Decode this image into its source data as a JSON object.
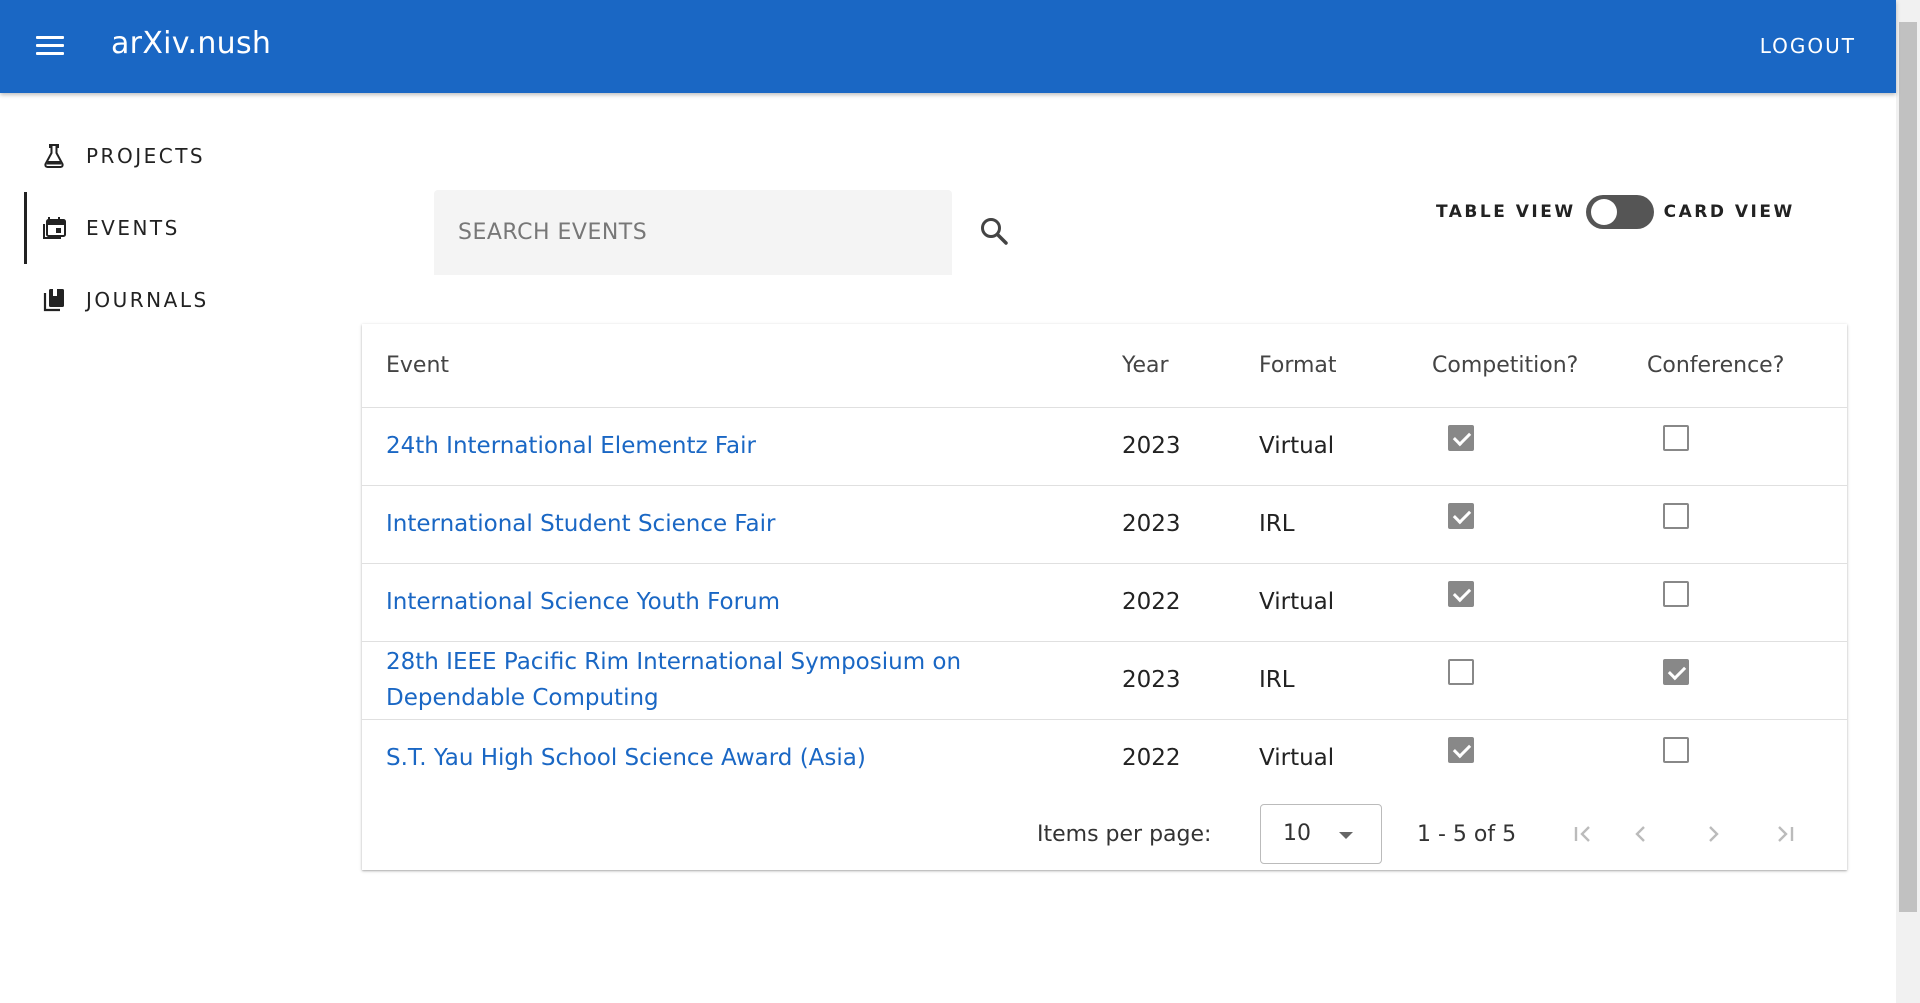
{
  "header": {
    "title": "arXiv.nush",
    "logout_label": "LOGOUT",
    "bg_color": "#1a67c4"
  },
  "sidebar": {
    "items": [
      {
        "label": "PROJECTS",
        "icon": "flask-icon",
        "active": false
      },
      {
        "label": "EVENTS",
        "icon": "event-calendar-icon",
        "active": true
      },
      {
        "label": "JOURNALS",
        "icon": "book-icon",
        "active": false
      }
    ]
  },
  "search": {
    "placeholder": "SEARCH EVENTS",
    "value": ""
  },
  "view_toggle": {
    "left_label": "TABLE VIEW",
    "right_label": "CARD VIEW",
    "state": "table"
  },
  "table": {
    "columns": [
      "Event",
      "Year",
      "Format",
      "Competition?",
      "Conference?"
    ],
    "rows": [
      {
        "event": "24th International Elementz Fair",
        "year": "2023",
        "format": "Virtual",
        "competition": true,
        "conference": false
      },
      {
        "event": "International Student Science Fair",
        "year": "2023",
        "format": "IRL",
        "competition": true,
        "conference": false
      },
      {
        "event": "International Science Youth Forum",
        "year": "2022",
        "format": "Virtual",
        "competition": true,
        "conference": false
      },
      {
        "event": "28th IEEE Pacific Rim International Symposium on Dependable Computing",
        "year": "2023",
        "format": "IRL",
        "competition": false,
        "conference": true
      },
      {
        "event": "S.T. Yau High School Science Award (Asia)",
        "year": "2022",
        "format": "Virtual",
        "competition": true,
        "conference": false
      }
    ]
  },
  "paginator": {
    "items_per_page_label": "Items per page:",
    "items_per_page_value": "10",
    "range_label": "1 - 5 of 5"
  }
}
